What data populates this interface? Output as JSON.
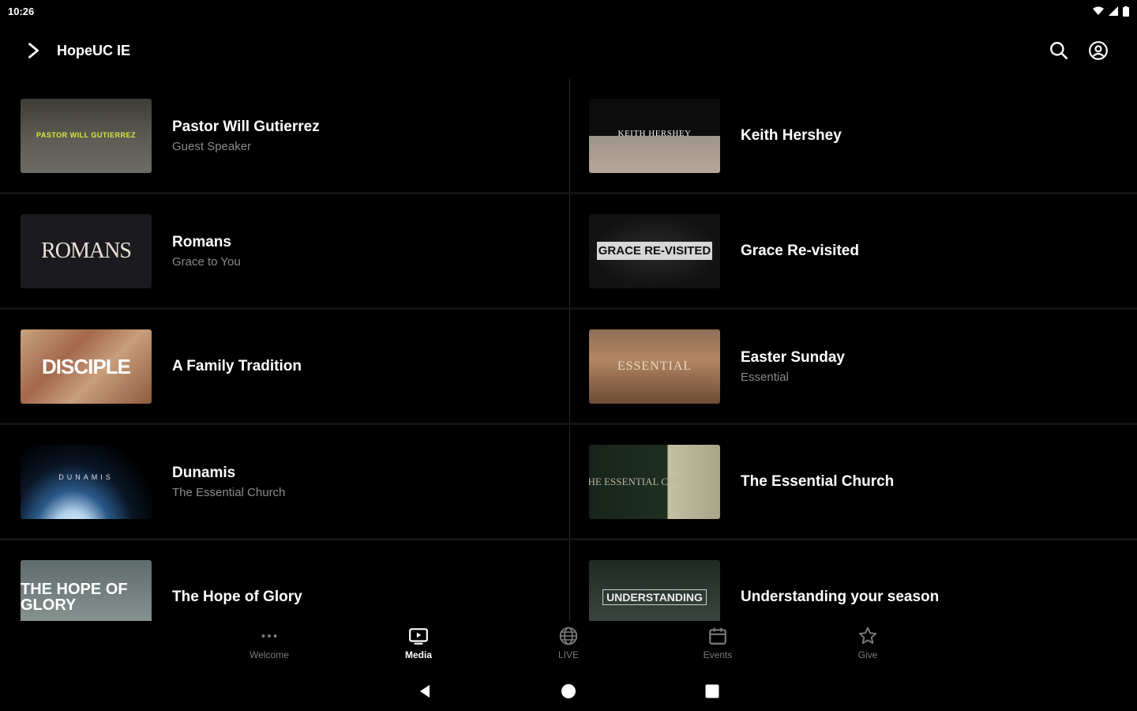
{
  "status_bar": {
    "time": "10:26"
  },
  "app_bar": {
    "title": "HopeUC IE",
    "icons": [
      "chevron-right-icon",
      "search-icon",
      "account-circle-icon"
    ]
  },
  "media_items": [
    {
      "title": "Pastor Will Gutierrez",
      "subtitle": "Guest Speaker",
      "thumb_text": "PASTOR WILL GUTIERREZ"
    },
    {
      "title": "Keith Hershey",
      "subtitle": "",
      "thumb_text": "KEITH HERSHEY"
    },
    {
      "title": "Romans",
      "subtitle": "Grace to You",
      "thumb_text": "ROMANS"
    },
    {
      "title": "Grace Re-visited",
      "subtitle": "",
      "thumb_text": "GRACE RE-VISITED"
    },
    {
      "title": "A Family Tradition",
      "subtitle": "",
      "thumb_text": "DISCIPLE"
    },
    {
      "title": "Easter Sunday",
      "subtitle": "Essential",
      "thumb_text": "ESSENTIAL"
    },
    {
      "title": "Dunamis",
      "subtitle": "The Essential Church",
      "thumb_text": "DUNAMIS"
    },
    {
      "title": "The Essential Church",
      "subtitle": "",
      "thumb_text": "THE ESSENTIAL CHURCH"
    },
    {
      "title": "The Hope of Glory",
      "subtitle": "",
      "thumb_text": "THE HOPE OF GLORY"
    },
    {
      "title": "Understanding your season",
      "subtitle": "",
      "thumb_text": "UNDERSTANDING"
    }
  ],
  "bottom_nav": [
    {
      "label": "Welcome",
      "icon": "more-horizontal-icon",
      "active": false
    },
    {
      "label": "Media",
      "icon": "tv-play-icon",
      "active": true
    },
    {
      "label": "LIVE",
      "icon": "globe-icon",
      "active": false
    },
    {
      "label": "Events",
      "icon": "calendar-icon",
      "active": false
    },
    {
      "label": "Give",
      "icon": "star-icon",
      "active": false
    }
  ],
  "system_nav": [
    "back-icon",
    "home-icon",
    "recents-icon"
  ]
}
